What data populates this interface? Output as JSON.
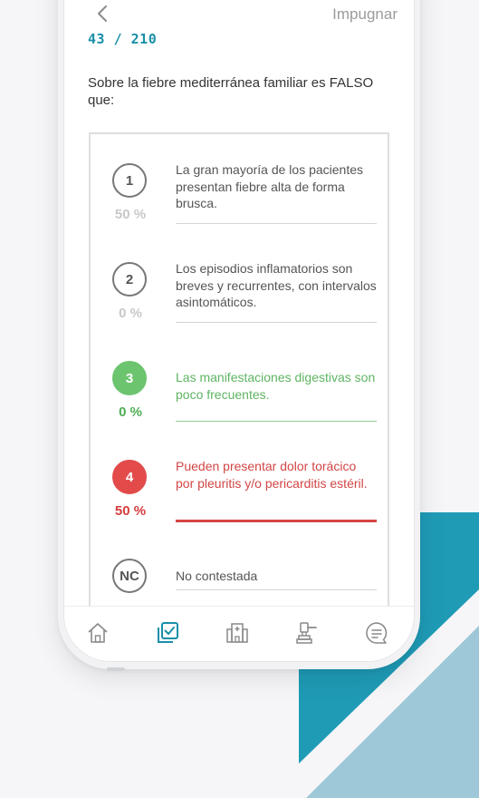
{
  "header": {
    "back_icon": "chevron-left-icon",
    "action_label": "Impugnar",
    "counter": "43 / 210"
  },
  "question": {
    "text": "Sobre la fiebre mediterránea familiar es FALSO que:"
  },
  "options": [
    {
      "badge": "1",
      "percent": "50 %",
      "text": "La gran mayoría de los pacientes presentan fiebre alta de forma brusca.",
      "state": "neutral"
    },
    {
      "badge": "2",
      "percent": "0 %",
      "text": "Los episodios inflamatorios son breves y recurrentes, con intervalos asintomáticos.",
      "state": "neutral"
    },
    {
      "badge": "3",
      "percent": "0 %",
      "text": "Las manifestaciones digestivas son poco frecuentes.",
      "state": "correct"
    },
    {
      "badge": "4",
      "percent": "50 %",
      "text": "Pueden presentar dolor torácico por pleuritis y/o pericarditis estéril.",
      "state": "selected-wrong"
    },
    {
      "badge": "NC",
      "percent": "",
      "text": "No contestada",
      "state": "neutral"
    }
  ],
  "tabbar": {
    "items": [
      "home-icon",
      "tests-icon",
      "hospital-icon",
      "gavel-icon",
      "chat-icon"
    ],
    "active": "tests-icon"
  },
  "colors": {
    "accent": "#1a8fa8",
    "correct": "#6cc46f",
    "wrong": "#e34b4b",
    "decor_teal": "#1f9bb6",
    "decor_light": "#9ec8d8"
  }
}
